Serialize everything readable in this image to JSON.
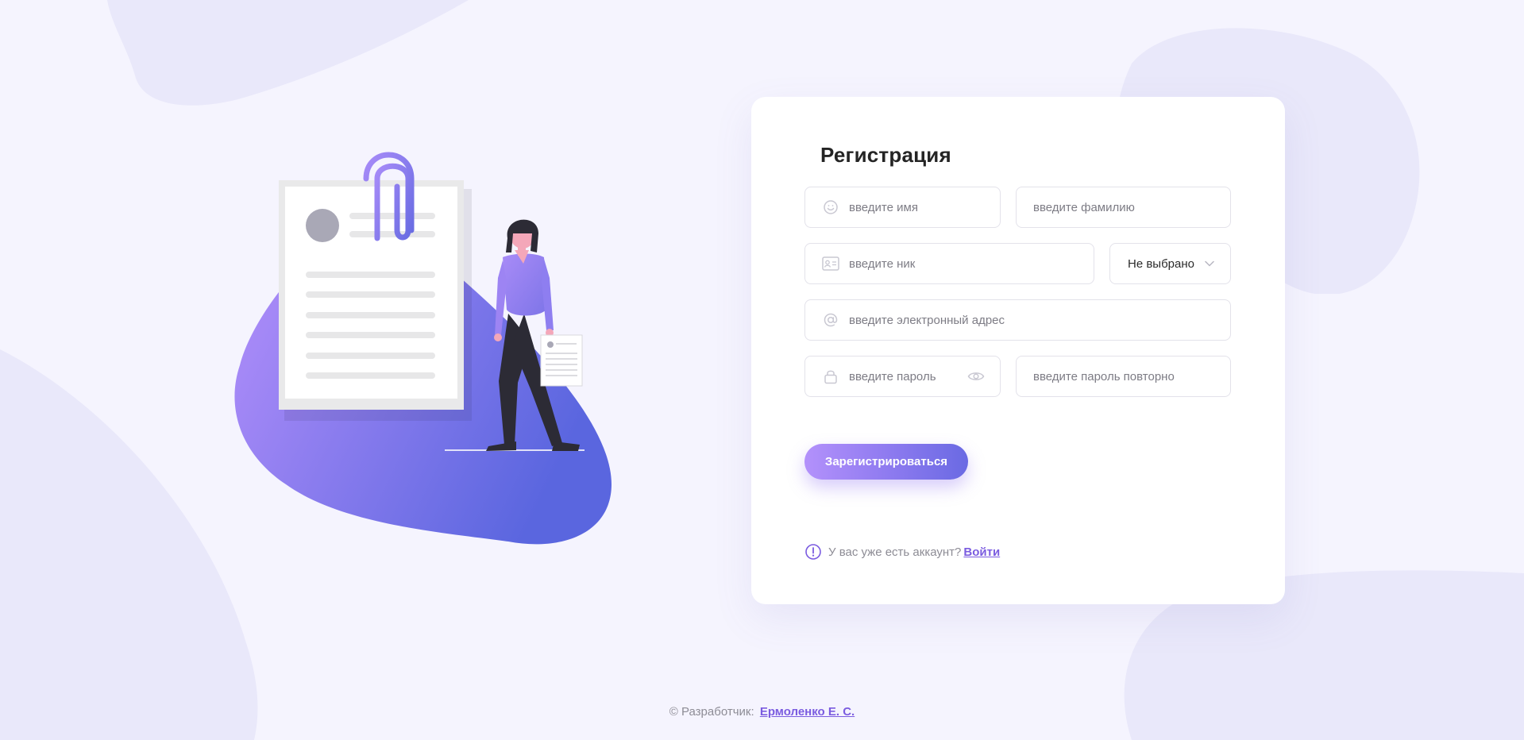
{
  "form": {
    "title": "Регистрация",
    "first_name_placeholder": "введите имя",
    "last_name_placeholder": "введите фамилию",
    "nick_placeholder": "введите ник",
    "gender_select_value": "Не выбрано",
    "email_placeholder": "введите электронный адрес",
    "password_placeholder": "введите пароль",
    "password_repeat_placeholder": "введите пароль повторно",
    "submit_label": "Зарегистрироваться"
  },
  "account_note": {
    "text": "У вас уже есть аккаунт?",
    "login_link": "Войти"
  },
  "footer": {
    "prefix": "© Разработчик:",
    "developer_link": "Ермоленко Е. С."
  },
  "icons": {
    "first_name": "smile-icon",
    "nick": "id-card-icon",
    "gender_select": "chevron-down-icon",
    "email": "at-sign-icon",
    "password": "lock-icon",
    "password_toggle": "eye-icon",
    "note": "info-circle-icon"
  },
  "colors": {
    "background": "#f5f4fe",
    "card": "#ffffff",
    "accent_start": "#b391fb",
    "accent_end": "#6a6ae3",
    "link": "#7b5ce0",
    "placeholder": "#7d7c85"
  }
}
